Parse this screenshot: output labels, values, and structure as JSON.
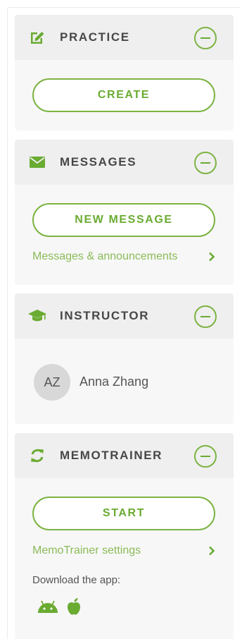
{
  "accent_color": "#7cb342",
  "practice": {
    "title": "PRACTICE",
    "icon": "edit-icon",
    "create_label": "CREATE"
  },
  "messages": {
    "title": "MESSAGES",
    "icon": "envelope-icon",
    "new_message_label": "NEW MESSAGE",
    "link_label": "Messages & announcements"
  },
  "instructor": {
    "title": "INSTRUCTOR",
    "icon": "graduation-cap-icon",
    "initials": "AZ",
    "name": "Anna Zhang"
  },
  "memotrainer": {
    "title": "MEMOTRAINER",
    "icon": "refresh-icon",
    "start_label": "START",
    "settings_label": "MemoTrainer settings",
    "download_label": "Download the app:",
    "apps": [
      "android-icon",
      "apple-icon"
    ]
  }
}
